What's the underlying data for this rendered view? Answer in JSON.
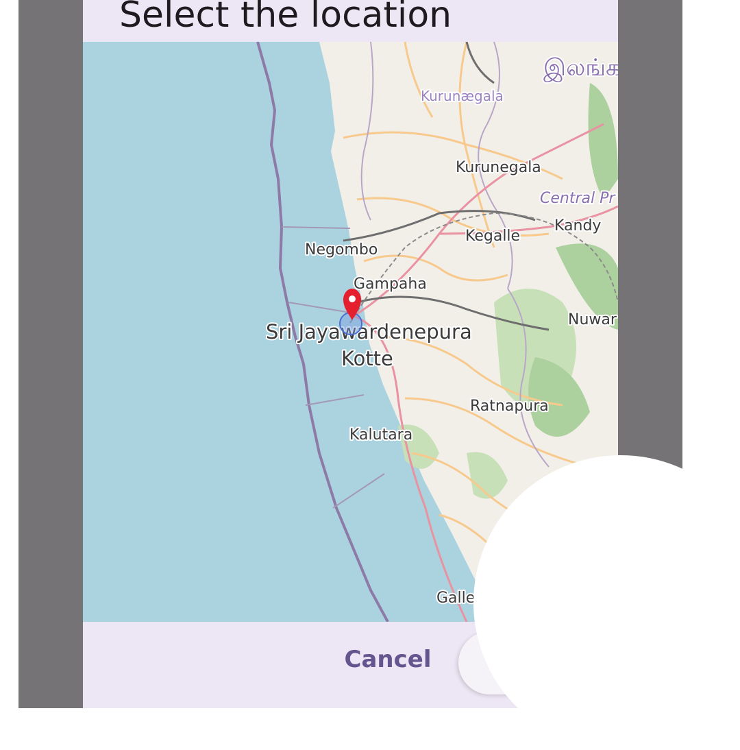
{
  "dialog": {
    "title": "Select the location",
    "cancel_label": "Cancel",
    "ok_label": ""
  },
  "map": {
    "labels": [
      {
        "id": "sinhala-script-label",
        "text": "இலங்க"
      },
      {
        "id": "kurunaegala-sinhala",
        "text": "Kurunægala"
      },
      {
        "id": "kurunegala",
        "text": "Kurunegala"
      },
      {
        "id": "central-province",
        "text": "Central Pr"
      },
      {
        "id": "kandy",
        "text": "Kandy"
      },
      {
        "id": "kegalle",
        "text": "Kegalle"
      },
      {
        "id": "negombo",
        "text": "Negombo"
      },
      {
        "id": "gampaha",
        "text": "Gampaha"
      },
      {
        "id": "nuwara",
        "text": "Nuwar"
      },
      {
        "id": "sri-jayawardenepura",
        "text": "Sri Jayawardenepura"
      },
      {
        "id": "kotte",
        "text": "Kotte"
      },
      {
        "id": "ratnapura",
        "text": "Ratnapura"
      },
      {
        "id": "kalutara",
        "text": "Kalutara"
      },
      {
        "id": "galle",
        "text": "Galle"
      }
    ],
    "colors": {
      "sea": "#aad3df",
      "land": "#f2efe9",
      "forest": "#add19e",
      "primary_road": "#e892a2",
      "secondary_road": "#f7c98c",
      "boundary": "#8e7aa6",
      "marker": "#e5202e"
    }
  }
}
